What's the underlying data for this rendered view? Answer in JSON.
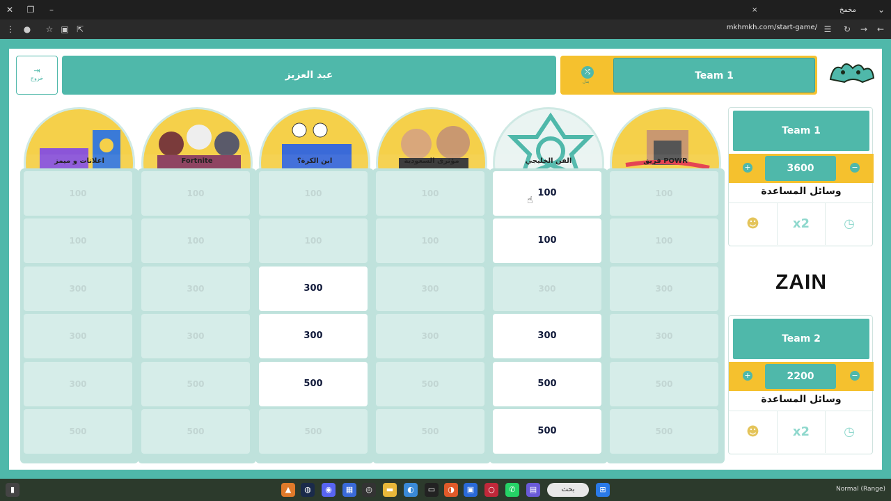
{
  "browser": {
    "tab_title": "مخمخ",
    "url": "mkhmkh.com/start-game/",
    "close_tab": "×",
    "new_tab": "+",
    "minimize": "–",
    "restore": "❐",
    "close_window": "✕",
    "menu": "⌄"
  },
  "header": {
    "exit_label": "خروج",
    "exit_icon": "⇥",
    "current_player": "عبد العزيز",
    "turn_team": "Team 1",
    "swap_label": "بدل",
    "swap_icon": "⤭"
  },
  "categories": [
    {
      "label": "اعلانات و ميمز"
    },
    {
      "label": "Fortnite"
    },
    {
      "label": "ابن الكرة؟"
    },
    {
      "label": "مؤثرى السعودية"
    },
    {
      "label": "الفن الخليجي"
    },
    {
      "label": "فريق POWR"
    }
  ],
  "board": {
    "columns": [
      {
        "cells": [
          {
            "v": "100",
            "on": false
          },
          {
            "v": "100",
            "on": false
          },
          {
            "v": "300",
            "on": false
          },
          {
            "v": "300",
            "on": false
          },
          {
            "v": "300",
            "on": false
          },
          {
            "v": "500",
            "on": false
          }
        ]
      },
      {
        "cells": [
          {
            "v": "100",
            "on": false
          },
          {
            "v": "100",
            "on": false
          },
          {
            "v": "300",
            "on": false
          },
          {
            "v": "300",
            "on": false
          },
          {
            "v": "500",
            "on": false
          },
          {
            "v": "500",
            "on": false
          }
        ]
      },
      {
        "cells": [
          {
            "v": "100",
            "on": false
          },
          {
            "v": "100",
            "on": false
          },
          {
            "v": "300",
            "on": true
          },
          {
            "v": "300",
            "on": true
          },
          {
            "v": "500",
            "on": true
          },
          {
            "v": "500",
            "on": false
          }
        ]
      },
      {
        "cells": [
          {
            "v": "100",
            "on": false
          },
          {
            "v": "100",
            "on": false
          },
          {
            "v": "300",
            "on": false
          },
          {
            "v": "300",
            "on": false
          },
          {
            "v": "500",
            "on": false
          },
          {
            "v": "500",
            "on": false
          }
        ]
      },
      {
        "cells": [
          {
            "v": "100",
            "on": true
          },
          {
            "v": "100",
            "on": true
          },
          {
            "v": "300",
            "on": false
          },
          {
            "v": "300",
            "on": true
          },
          {
            "v": "500",
            "on": true
          },
          {
            "v": "500",
            "on": true
          }
        ]
      },
      {
        "cells": [
          {
            "v": "100",
            "on": false
          },
          {
            "v": "100",
            "on": false
          },
          {
            "v": "300",
            "on": false
          },
          {
            "v": "300",
            "on": false
          },
          {
            "v": "500",
            "on": false
          },
          {
            "v": "500",
            "on": false
          }
        ]
      }
    ]
  },
  "teams": [
    {
      "name": "Team 1",
      "score": "3600",
      "aids_title": "وسائل المساعدة",
      "plus": "+",
      "minus": "−",
      "aid_double": "x2"
    },
    {
      "name": "Team 2",
      "score": "2200",
      "aids_title": "وسائل المساعدة",
      "plus": "+",
      "minus": "−",
      "aid_double": "x2"
    }
  ],
  "sponsor": {
    "name": "ZAIN"
  },
  "taskbar": {
    "search_label": "بحث",
    "status": "Normal (Range)"
  },
  "colors": {
    "teal": "#4fb8aa",
    "yellow": "#f5c12e",
    "cell_off": "#d6ede9",
    "cell_on": "#ffffff"
  }
}
